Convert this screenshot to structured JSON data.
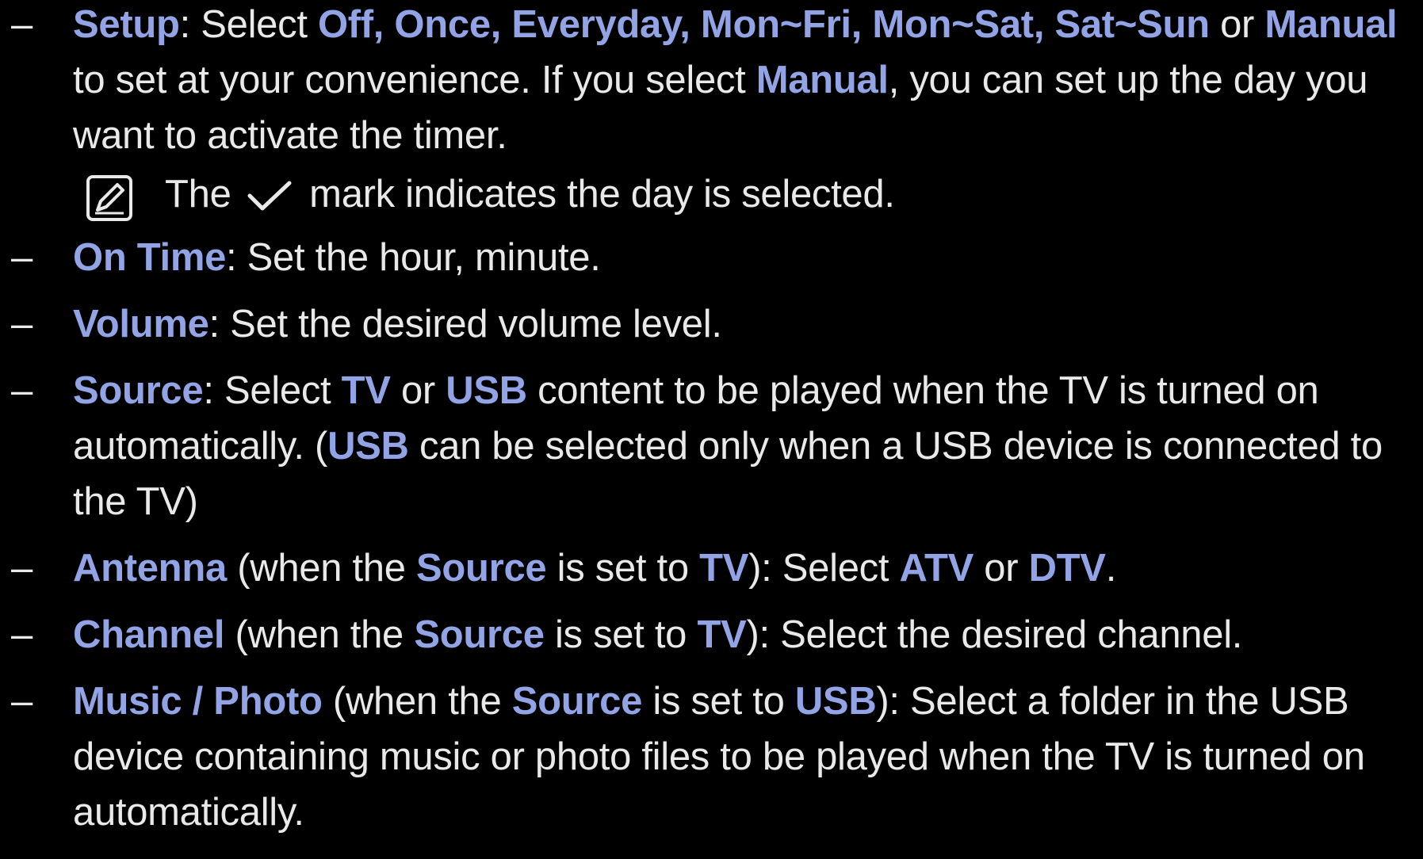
{
  "colors": {
    "background": "#000000",
    "text": "#e9e9e9",
    "highlight": "#93a4e6"
  },
  "dash": "–",
  "items": [
    {
      "term": "Setup",
      "sep1": ": Select ",
      "options1": "Off, Once, Everyday, Mon~Fri, Mon~Sat, Sat~Sun",
      "sep2": " or ",
      "options2": "Manual",
      "sep3": " to set at your convenience. If you select ",
      "options3": "Manual",
      "sep4": ", you can set up the day you want to activate the timer."
    },
    {
      "term": "On Time",
      "text": ": Set the hour, minute."
    },
    {
      "term": "Volume",
      "text": ": Set the desired volume level."
    },
    {
      "term": "Source",
      "sep1": ": Select ",
      "hl1": "TV",
      "sep2": " or ",
      "hl2": "USB",
      "sep3": " content to be played when the TV is turned on automatically. (",
      "hl3": "USB",
      "sep4": " can be selected only when a USB device is connected to the TV)"
    },
    {
      "term": "Antenna",
      "sep1": " (when the ",
      "hl1": "Source",
      "sep2": " is set to ",
      "hl2": "TV",
      "sep3": "): Select ",
      "hl3": "ATV",
      "sep4": " or ",
      "hl4": "DTV",
      "sep5": "."
    },
    {
      "term": "Channel",
      "sep1": " (when the ",
      "hl1": "Source",
      "sep2": " is set to ",
      "hl2": "TV",
      "sep3": "): Select the desired channel."
    },
    {
      "term": "Music / Photo",
      "sep1": " (when the ",
      "hl1": "Source",
      "sep2": " is set to ",
      "hl2": "USB",
      "sep3": "): Select a folder in the USB device containing music or photo files to be played when the TV is turned on automatically."
    }
  ],
  "note": {
    "icon": "note-pencil-icon",
    "before": "The ",
    "check_icon": "check-mark-icon",
    "after": " mark indicates the day is selected."
  }
}
